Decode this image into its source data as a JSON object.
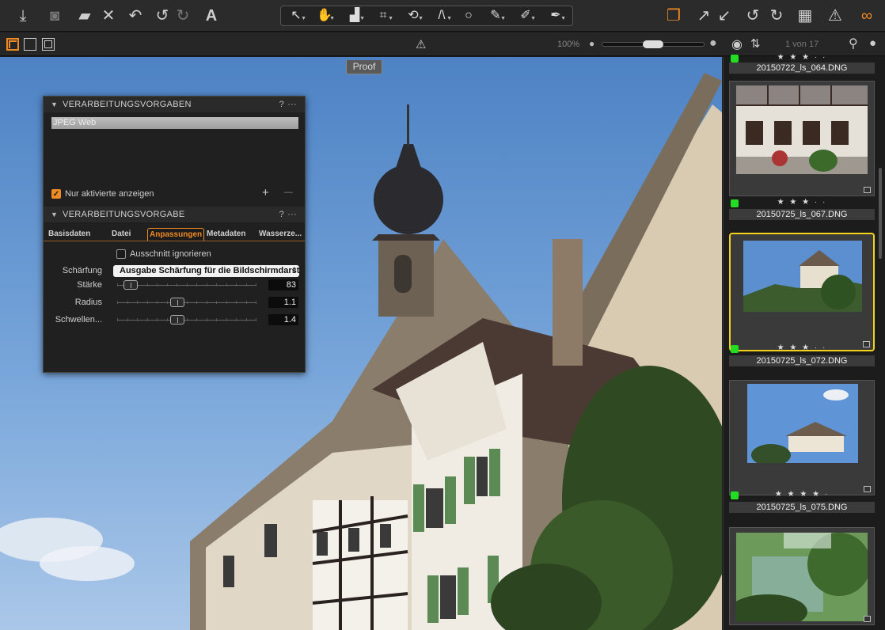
{
  "toolbar": {
    "left_icons": [
      "import-icon",
      "camera-icon",
      "folder-icon",
      "close-icon",
      "undo-history-icon",
      "undo-icon",
      "redo-icon",
      "text-tool-icon"
    ],
    "tools": [
      "cursor-tool-icon",
      "pan-tool-icon",
      "crop-tool-icon",
      "crop-icon",
      "rotate-tool-icon",
      "keystone-tool-icon",
      "circle-tool-icon",
      "brush-tool-icon",
      "picker-tool-icon",
      "annotate-tool-icon"
    ],
    "right_icons": [
      "stack-icon",
      "copy-adjustments-icon",
      "apply-adjustments-icon",
      "reset-icon",
      "redo-all-icon",
      "grid-icon",
      "warning-icon",
      "glasses-icon"
    ]
  },
  "subbar": {
    "zoom": "100%",
    "counter": "1 von 17"
  },
  "viewer": {
    "proof_label": "Proof"
  },
  "panel": {
    "section1_title": "VERARBEITUNGSVORGABEN",
    "preset_item": "JPEG Web",
    "only_active_label": "Nur aktivierte anzeigen",
    "section2_title": "VERARBEITUNGSVORGABE",
    "help": "?",
    "more": "···",
    "add": "+",
    "remove": "—",
    "tabs": [
      "Basisdaten",
      "Datei",
      "Anpassungen",
      "Metadaten",
      "Wasserze..."
    ],
    "active_tab": "Anpassungen",
    "ignore_crop_label": "Ausschnitt ignorieren",
    "sharpening_label": "Schärfung",
    "sharpening_value": "Ausgabe Schärfung für die Bildschirmdarst",
    "sliders": [
      {
        "label": "Stärke",
        "value": "83",
        "level": 0.06
      },
      {
        "label": "Radius",
        "value": "1.1",
        "level": 0.4
      },
      {
        "label": "Schwellen...",
        "value": "1.4",
        "level": 0.4
      }
    ]
  },
  "browser": {
    "files": [
      {
        "name": "20150722_ls_064.DNG",
        "rating": "★ ★ ★ · ·"
      },
      {
        "name": "20150725_ls_067.DNG",
        "rating": "★ ★ ★ · ·"
      },
      {
        "name": "20150725_ls_072.DNG",
        "rating": "★ ★ ★ · ·"
      },
      {
        "name": "20150725_ls_075.DNG",
        "rating": "★ ★ ★ ★ ·"
      }
    ]
  }
}
